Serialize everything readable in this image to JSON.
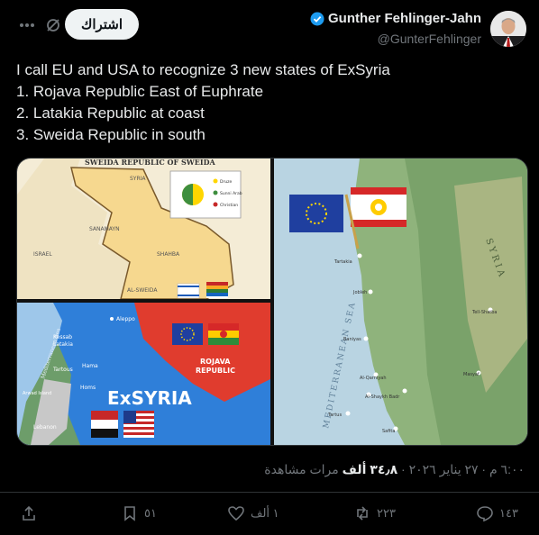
{
  "header": {
    "subscribe_label": "اشتراك",
    "display_name": "Gunther Fehlinger-Jahn",
    "handle": "@GunterFehlinger"
  },
  "tweet": {
    "lines": [
      "I call EU and USA to recognize 3 new states of ExSyria",
      "1. Rojava Republic East of Euphrate",
      "2. Latakia Republic at coast",
      "3. Sweida Republic in south"
    ]
  },
  "media": {
    "sweida_map": {
      "title": "SWEIDA REPUBLIC OF SWEIDA",
      "syria": "SYRIA",
      "israel": "ISRAEL",
      "sanamayn": "SANAMAYN",
      "shahba": "SHAHBA",
      "sweida": "AL-SWEIDA",
      "legend": [
        "Druze",
        "Sunni Arab",
        "Christian"
      ]
    },
    "exsyria_map": {
      "title": "ExSYRIA",
      "rojava": "ROJAVA\nREPUBLIC",
      "sea": "Mediterranean Sea",
      "cities": [
        "Aleppo",
        "Kessab",
        "Latakia",
        "Tartous",
        "Hama",
        "Homs",
        "Lebanon",
        "Arwad Island"
      ],
      "rojava_line1": "ROJAVA",
      "rojava_line2": "REPUBLIC"
    },
    "coast_map": {
      "sea": "MEDITERRANEAN SEA",
      "syria": "SYRIA",
      "cities": [
        "Tartakia",
        "Jobleh",
        "Baniyas",
        "Al-Qarniyah",
        "Al-Shaykh Badr",
        "Tartus",
        "Safita",
        "Tell-Shatba",
        "Masyaf",
        "Al-Qarniyah"
      ]
    }
  },
  "meta": {
    "time_date": "٦:٠٠ م · ٢٧ يناير ٢٠٢٦ · ",
    "views_count": "٣٤٫٨ ألف",
    "views_label": " مرات مشاهدة"
  },
  "actions": {
    "replies": "١٤٣",
    "reposts": "٢٢٣",
    "likes": "١ ألف",
    "bookmarks": "٥١"
  },
  "colors": {
    "background": "#000000",
    "text": "#e7e9ea",
    "muted": "#71767b",
    "verified": "#1d9bf0",
    "rojava_red": "#e03c2e",
    "exsyria_blue": "#2f7fd9"
  }
}
